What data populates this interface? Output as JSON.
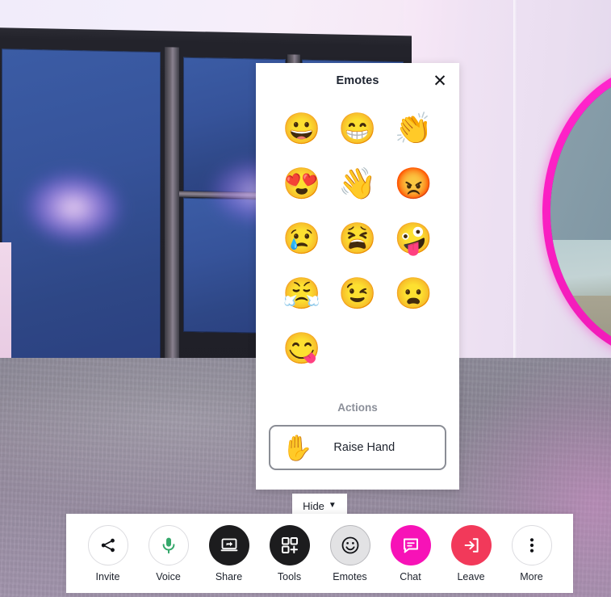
{
  "scene": {
    "description": "3d-virtual-room-background",
    "wall_color": "#f3eefb",
    "window_pane_color": "#36539a",
    "arch_accent_color": "#ff2ad4",
    "floor_color": "#928b9e"
  },
  "panel": {
    "title": "Emotes",
    "close_icon": "close-icon",
    "close_glyph": "✕",
    "emotes": [
      {
        "name": "grinning-face",
        "glyph": "😀"
      },
      {
        "name": "beaming-face-smiling-eyes",
        "glyph": "😁"
      },
      {
        "name": "clapping-hands",
        "glyph": "👏"
      },
      {
        "name": "smiling-face-heart-eyes",
        "glyph": "😍"
      },
      {
        "name": "waving-hand",
        "glyph": "👋"
      },
      {
        "name": "pouting-angry-face",
        "glyph": "😡"
      },
      {
        "name": "crying-face",
        "glyph": "😢"
      },
      {
        "name": "weary-tired-face",
        "glyph": "😫"
      },
      {
        "name": "zany-face",
        "glyph": "🤪"
      },
      {
        "name": "face-with-steam-from-nose",
        "glyph": "😤"
      },
      {
        "name": "winking-face",
        "glyph": "😉"
      },
      {
        "name": "frowning-face-open-mouth",
        "glyph": "😦"
      },
      {
        "name": "face-savoring-food",
        "glyph": "😋"
      }
    ],
    "actions_title": "Actions",
    "raise_hand": {
      "label": "Raise Hand",
      "icon": "raised-hand-emoji",
      "glyph": "✋"
    }
  },
  "hide_button": {
    "label": "Hide",
    "caret": "▼"
  },
  "toolbar": {
    "items": [
      {
        "label": "Invite",
        "icon": "share-nodes-icon",
        "style": "outline"
      },
      {
        "label": "Voice",
        "icon": "microphone-icon",
        "style": "outline"
      },
      {
        "label": "Share",
        "icon": "screen-share-icon",
        "style": "dark"
      },
      {
        "label": "Tools",
        "icon": "grid-plus-icon",
        "style": "dark"
      },
      {
        "label": "Emotes",
        "icon": "smiley-face-icon",
        "style": "active"
      },
      {
        "label": "Chat",
        "icon": "chat-bubble-icon",
        "style": "magenta"
      },
      {
        "label": "Leave",
        "icon": "exit-arrow-icon",
        "style": "red"
      },
      {
        "label": "More",
        "icon": "three-dots-icon",
        "style": "outline"
      }
    ],
    "colors": {
      "dark": "#1c1c1e",
      "magenta": "#f712b7",
      "red": "#f2395a",
      "mic_green": "#35a86b",
      "active_bg": "#e2e2e4"
    }
  }
}
